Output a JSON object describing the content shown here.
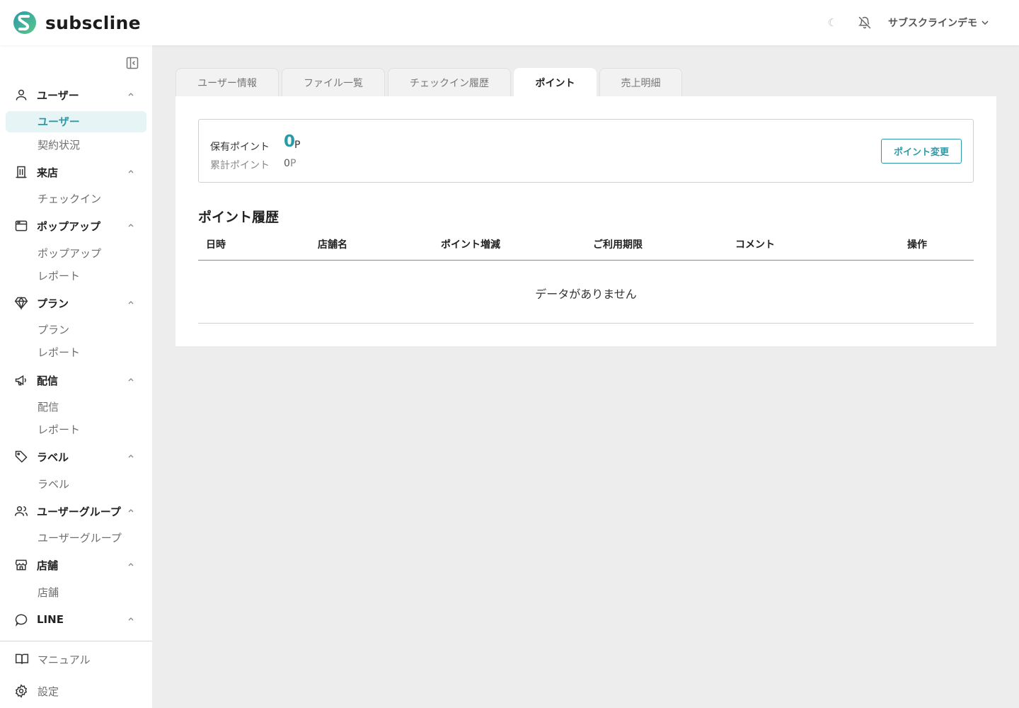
{
  "app": {
    "brand": "subscline",
    "accent_color": "#2a9aa8"
  },
  "header": {
    "account_name": "サブスクラインデモ",
    "icons": [
      "moon-icon",
      "bell-off-icon",
      "chevron-down-icon"
    ]
  },
  "sidebar": {
    "groups": [
      {
        "label": "ユーザー",
        "icon": "user-icon",
        "items": [
          "ユーザー",
          "契約状況"
        ]
      },
      {
        "label": "来店",
        "icon": "building-icon",
        "items": [
          "チェックイン"
        ]
      },
      {
        "label": "ポップアップ",
        "icon": "window-icon",
        "items": [
          "ポップアップ",
          "レポート"
        ]
      },
      {
        "label": "プラン",
        "icon": "gem-icon",
        "items": [
          "プラン",
          "レポート"
        ]
      },
      {
        "label": "配信",
        "icon": "megaphone-icon",
        "items": [
          "配信",
          "レポート"
        ]
      },
      {
        "label": "ラベル",
        "icon": "tag-icon",
        "items": [
          "ラベル"
        ]
      },
      {
        "label": "ユーザーグループ",
        "icon": "users-icon",
        "items": [
          "ユーザーグループ"
        ]
      },
      {
        "label": "店舗",
        "icon": "store-icon",
        "items": [
          "店舗"
        ]
      },
      {
        "label": "LINE",
        "icon": "chat-bubble-icon",
        "items": []
      }
    ],
    "active_item": "ユーザー",
    "footer": [
      {
        "label": "マニュアル",
        "icon": "book-icon"
      },
      {
        "label": "設定",
        "icon": "gear-icon"
      }
    ]
  },
  "tabs": [
    {
      "label": "ユーザー情報",
      "active": false
    },
    {
      "label": "ファイル一覧",
      "active": false
    },
    {
      "label": "チェックイン履歴",
      "active": false
    },
    {
      "label": "ポイント",
      "active": true
    },
    {
      "label": "売上明細",
      "active": false
    }
  ],
  "points": {
    "held_label": "保有ポイント",
    "held_value": "0",
    "held_unit": "P",
    "total_label": "累計ポイント",
    "total_value": "0",
    "total_unit": "P",
    "change_button": "ポイント変更"
  },
  "history": {
    "title": "ポイント履歴",
    "columns": [
      "日時",
      "店舗名",
      "ポイント増減",
      "ご利用期限",
      "コメント",
      "操作"
    ],
    "rows": [],
    "empty_text": "データがありません"
  }
}
